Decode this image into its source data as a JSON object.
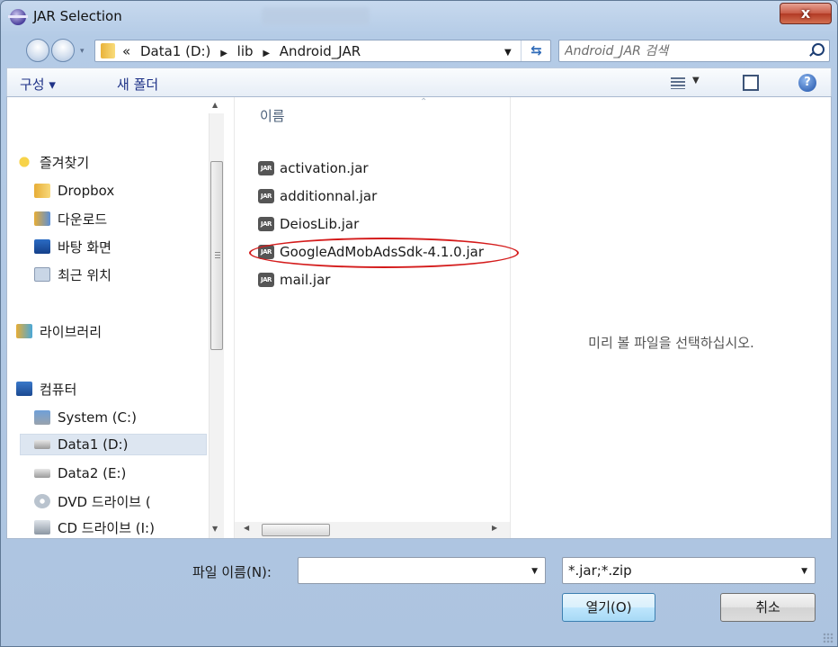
{
  "window": {
    "title": "JAR Selection",
    "close_label": "x"
  },
  "address": {
    "crumbs": [
      "«",
      "Data1 (D:)",
      "lib",
      "Android_JAR"
    ],
    "search_placeholder": "Android_JAR 검색"
  },
  "toolbar": {
    "organize": "구성 ▾",
    "new_folder": "새 폴더"
  },
  "sidebar": {
    "items": [
      {
        "label": "즐겨찾기",
        "icon": "star-icon"
      },
      {
        "label": "Dropbox",
        "icon": "folder-icon"
      },
      {
        "label": "다운로드",
        "icon": "download-folder-icon"
      },
      {
        "label": "바탕 화면",
        "icon": "desktop-icon"
      },
      {
        "label": "최근 위치",
        "icon": "recent-places-icon"
      },
      {
        "label": "라이브러리",
        "icon": "library-icon"
      },
      {
        "label": "컴퓨터",
        "icon": "computer-icon"
      },
      {
        "label": "System (C:)",
        "icon": "system-drive-icon"
      },
      {
        "label": "Data1 (D:)",
        "icon": "drive-icon",
        "selected": true
      },
      {
        "label": "Data2 (E:)",
        "icon": "drive-icon"
      },
      {
        "label": "DVD 드라이브 (",
        "icon": "dvd-icon"
      },
      {
        "label": "CD 드라이브 (I:)",
        "icon": "cd-icon"
      }
    ]
  },
  "files": {
    "column_header": "이름",
    "items": [
      "activation.jar",
      "additionnal.jar",
      "DeiosLib.jar",
      "GoogleAdMobAdsSdk-4.1.0.jar",
      "mail.jar"
    ],
    "highlighted": "GoogleAdMobAdsSdk-4.1.0.jar",
    "icon_label": "JAR"
  },
  "preview": {
    "message": "미리 볼 파일을 선택하십시오."
  },
  "bottom": {
    "filename_label": "파일 이름(N):",
    "filename_value": "",
    "filter_value": "*.jar;*.zip",
    "open_label": "열기(O)",
    "cancel_label": "취소"
  },
  "colors": {
    "highlight_circle": "#d41b1b",
    "link_text": "#1e3287"
  }
}
